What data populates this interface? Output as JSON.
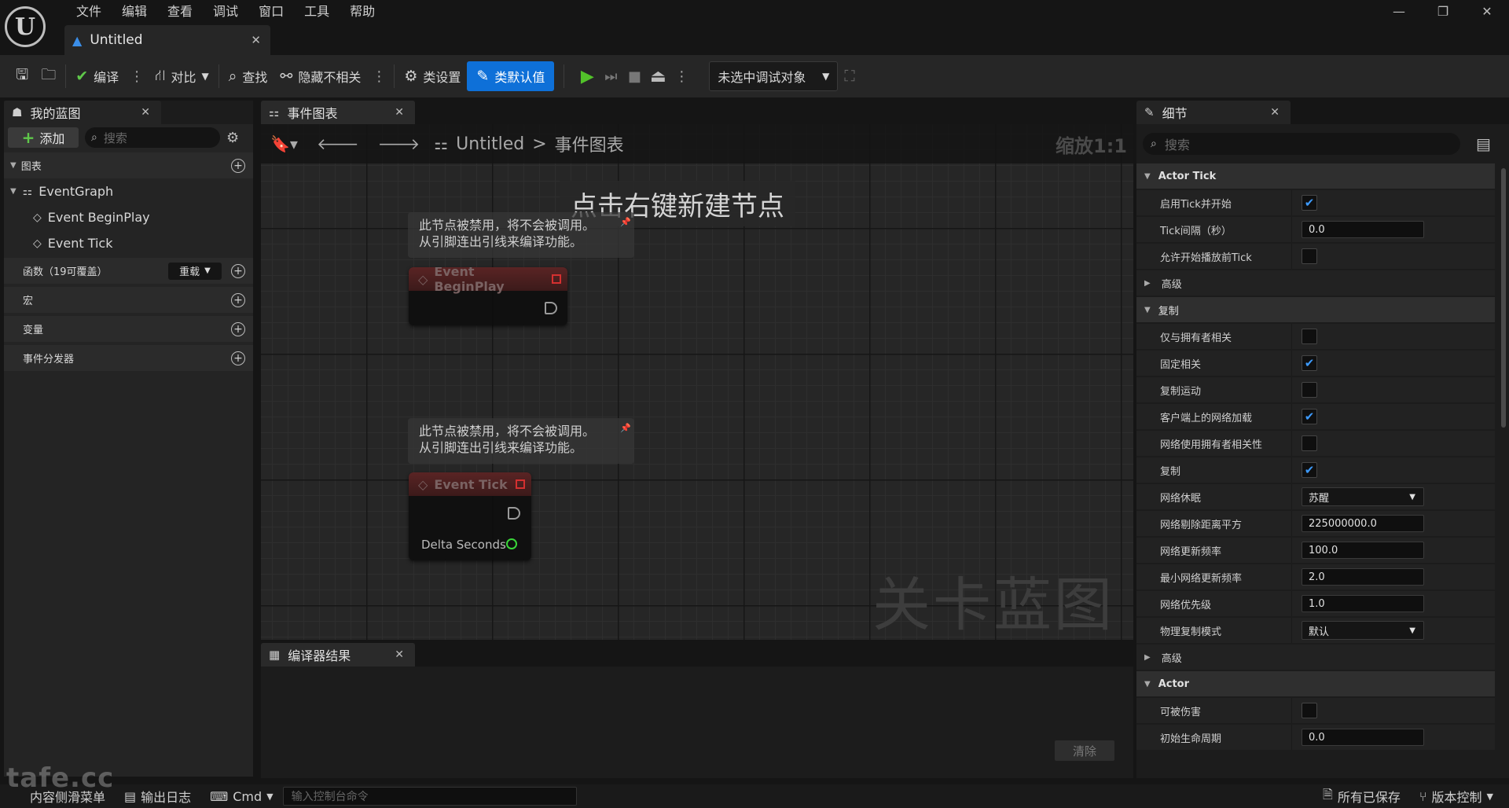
{
  "window": {
    "tab_title": "Untitled",
    "minimize": "—",
    "restore": "❐",
    "close": "✕"
  },
  "menu": [
    "文件",
    "编辑",
    "查看",
    "调试",
    "窗口",
    "工具",
    "帮助"
  ],
  "toolbar": {
    "compile": "编译",
    "diff": "对比",
    "find": "查找",
    "hide_unrelated": "隐藏不相关",
    "class_settings": "类设置",
    "class_defaults": "类默认值",
    "debug_target": "未选中调试对象"
  },
  "my_blueprint": {
    "tab": "我的蓝图",
    "add": "添加",
    "search_placeholder": "搜索",
    "graphs": "图表",
    "event_graph": "EventGraph",
    "events": [
      "Event BeginPlay",
      "Event Tick"
    ],
    "functions": "函数（19可覆盖）",
    "override": "重载",
    "macros": "宏",
    "variables": "变量",
    "dispatchers": "事件分发器"
  },
  "graph": {
    "tab": "事件图表",
    "breadcrumb_root": "Untitled",
    "breadcrumb_sep": ">",
    "breadcrumb_leaf": "事件图表",
    "zoom": "缩放1:1",
    "hint": "点击右键新建节点",
    "comment_line1": "此节点被禁用，将不会被调用。",
    "comment_line2": "从引脚连出引线来编译功能。",
    "node_beginplay": "Event BeginPlay",
    "node_tick": "Event Tick",
    "delta_seconds": "Delta Seconds",
    "watermark": "关卡蓝图"
  },
  "compiler": {
    "tab": "编译器结果",
    "clear": "清除"
  },
  "details": {
    "tab": "细节",
    "search_placeholder": "搜索",
    "actor_tick": "Actor Tick",
    "tick_enabled": "启用Tick并开始",
    "tick_interval": "Tick间隔（秒）",
    "tick_interval_value": "0.0",
    "tick_before_begin": "允许开始播放前Tick",
    "advanced": "高级",
    "replication": "复制",
    "only_relevant_owner": "仅与拥有者相关",
    "always_relevant": "固定相关",
    "replicate_movement": "复制运动",
    "net_load_on_client": "客户端上的网络加载",
    "net_use_owner_relevancy": "网络使用拥有者相关性",
    "replicates": "复制",
    "net_dormancy": "网络休眠",
    "net_dormancy_value": "苏醒",
    "net_cull_distance": "网络剔除距离平方",
    "net_cull_distance_value": "225000000.0",
    "net_update_freq": "网络更新频率",
    "net_update_freq_value": "100.0",
    "min_net_update_freq": "最小网络更新频率",
    "min_net_update_freq_value": "2.0",
    "net_priority": "网络优先级",
    "net_priority_value": "1.0",
    "physics_rep_mode": "物理复制模式",
    "physics_rep_mode_value": "默认",
    "actor": "Actor",
    "can_be_damaged": "可被伤害",
    "initial_life_span": "初始生命周期",
    "initial_life_span_value": "0.0"
  },
  "statusbar": {
    "content_drawer": "内容侧滑菜单",
    "output_log": "输出日志",
    "cmd": "Cmd",
    "console_placeholder": "输入控制台命令",
    "all_saved": "所有已保存",
    "source_control": "版本控制"
  },
  "watermark_site": "tafe.cc",
  "colors": {
    "accent": "#0e70d8",
    "play": "#52c22a",
    "check": "#3d9bff",
    "node_header": "#5a2424"
  }
}
